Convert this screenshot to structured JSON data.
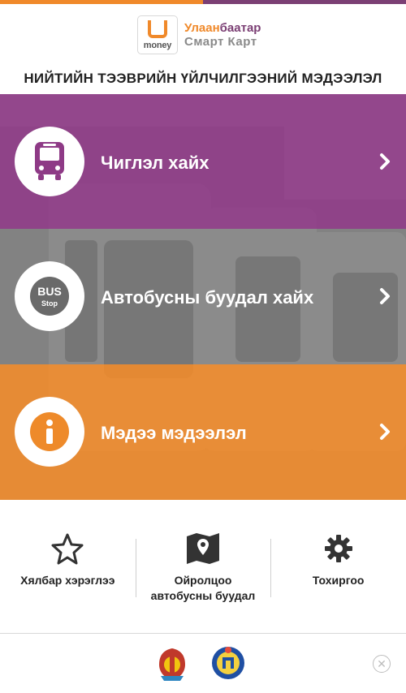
{
  "brand": {
    "logo_box_text": "money",
    "name_line1_part1": "Улаан",
    "name_line1_part2": "баатар",
    "name_line2": "Смарт Карт",
    "colors": {
      "orange": "#f0892a",
      "purple": "#7b3f74"
    }
  },
  "page_title": "НИЙТИЙН ТЭЭВРИЙН ҮЙЛЧИЛГЭЭНИЙ МЭДЭЭЛЭЛ",
  "menu": [
    {
      "label": "Чиглэл хайх",
      "icon": "bus-icon",
      "color": "#8e3a86"
    },
    {
      "label": "Автобусны буудал хайх",
      "icon": "bus-stop-icon",
      "badge_top": "BUS",
      "badge_bottom": "Stop",
      "color": "#6f6f6f"
    },
    {
      "label": "Мэдээ мэдээлэл",
      "icon": "info-icon",
      "color": "#ee8a2a"
    }
  ],
  "bottom_nav": [
    {
      "label": "Хялбар хэрэглээ",
      "icon": "star-icon"
    },
    {
      "label": "Ойролцоо автобусны буудал",
      "icon": "map-pin-icon"
    },
    {
      "label": "Тохиргоо",
      "icon": "gear-icon"
    }
  ],
  "ad_bar": {
    "close_symbol": "✕"
  }
}
